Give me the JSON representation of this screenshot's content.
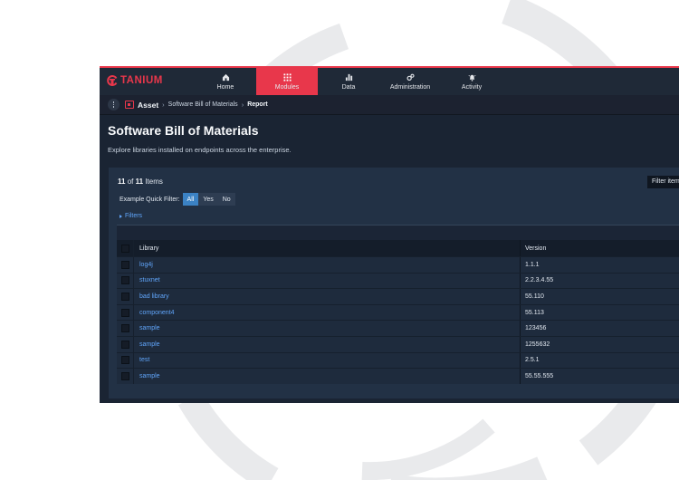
{
  "brand": {
    "name": "TANIUM",
    "accent": "#e8374b"
  },
  "nav": {
    "items": [
      {
        "label": "Home",
        "icon": "home-icon"
      },
      {
        "label": "Modules",
        "icon": "grid-icon",
        "active": true
      },
      {
        "label": "Data",
        "icon": "bar-chart-icon"
      },
      {
        "label": "Administration",
        "icon": "gears-icon"
      },
      {
        "label": "Activity",
        "icon": "bell-icon"
      }
    ]
  },
  "breadcrumb": {
    "root": "Asset",
    "middle": "Software Bill of Materials",
    "current": "Report"
  },
  "page": {
    "title": "Software Bill of Materials",
    "description": "Explore libraries installed on endpoints across the enterprise."
  },
  "grid": {
    "count_shown": "11",
    "count_of": "of",
    "count_total": "11",
    "count_suffix": "Items",
    "filter_placeholder": "Filter items",
    "quick_filter": {
      "label": "Example Quick Filter:",
      "options": [
        "All",
        "Yes",
        "No"
      ],
      "selected": "All"
    },
    "filters_label": "Filters",
    "columns": [
      "Library",
      "Version"
    ],
    "rows": [
      {
        "library": "log4j",
        "version": "1.1.1"
      },
      {
        "library": "stuxnet",
        "version": "2.2.3.4.55"
      },
      {
        "library": "bad library",
        "version": "55.110"
      },
      {
        "library": "component4",
        "version": "55.113"
      },
      {
        "library": "sample",
        "version": "123456"
      },
      {
        "library": "sample",
        "version": "1255632"
      },
      {
        "library": "test",
        "version": "2.5.1"
      },
      {
        "library": "sample",
        "version": "55.55.555"
      }
    ]
  }
}
